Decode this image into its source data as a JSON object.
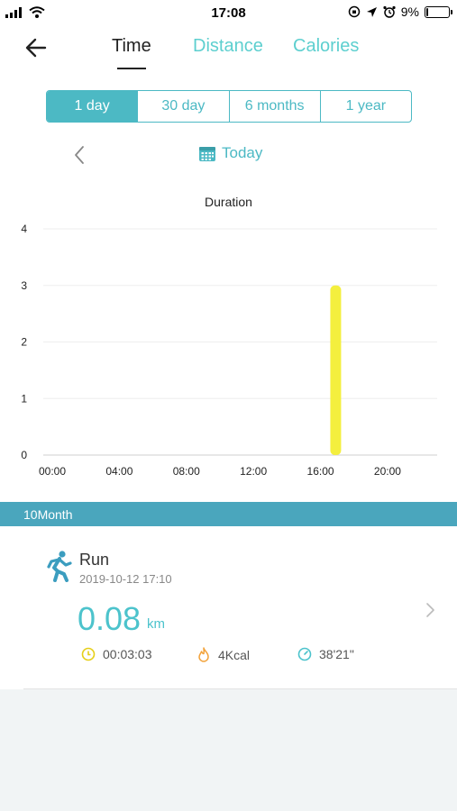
{
  "status_bar": {
    "time": "17:08",
    "battery": "9%",
    "battery_level": 0.09
  },
  "header": {
    "tabs": [
      {
        "label": "Time",
        "active": true
      },
      {
        "label": "Distance",
        "active": false
      },
      {
        "label": "Calories",
        "active": false
      }
    ]
  },
  "range": {
    "options": [
      "1 day",
      "30 day",
      "6 months",
      "1 year"
    ],
    "selected": "1 day"
  },
  "date_nav": {
    "today_label": "Today"
  },
  "chart_data": {
    "type": "bar",
    "title": "Duration",
    "x_ticks": [
      "00:00",
      "04:00",
      "08:00",
      "12:00",
      "16:00",
      "20:00"
    ],
    "y_ticks": [
      "0",
      "1",
      "2",
      "3",
      "4"
    ],
    "ylim": [
      0,
      4
    ],
    "xlim_hours": [
      0,
      23.5
    ],
    "bars": [
      {
        "hour": 17,
        "value": 3
      }
    ],
    "bar_color": "#f4ef3e",
    "grid": true
  },
  "section": {
    "label": "10Month"
  },
  "record": {
    "activity": "Run",
    "datetime": "2019-10-12 17:10",
    "distance": "0.08",
    "unit": "km",
    "duration": "00:03:03",
    "calories": "4Kcal",
    "pace": "38'21\""
  },
  "colors": {
    "accent": "#4cb9c4",
    "section_bar": "#4aa6bd",
    "bar": "#f4ef3e"
  }
}
